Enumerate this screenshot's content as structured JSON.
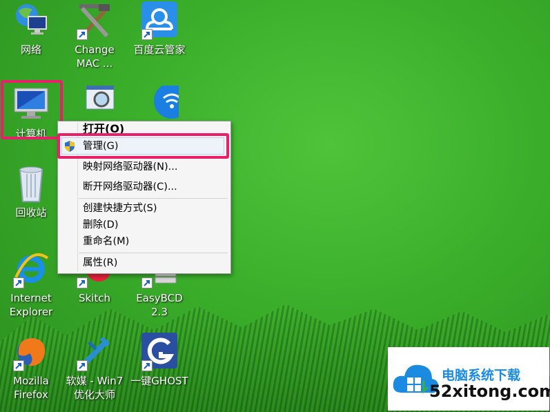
{
  "desktop": {
    "icons": [
      {
        "label": "网络",
        "icon": "network-icon"
      },
      {
        "label": "Change\nMAC ...",
        "icon": "change-mac-icon"
      },
      {
        "label": "百度云管家",
        "icon": "baidu-cloud-icon"
      },
      {
        "label": "计算机",
        "icon": "computer-icon"
      },
      {
        "label": "回收站",
        "icon": "recycle-bin-icon"
      },
      {
        "label": "Internet\nExplorer",
        "icon": "internet-explorer-icon"
      },
      {
        "label": "Skitch",
        "icon": "skitch-icon"
      },
      {
        "label": "EasyBCD\n2.3",
        "icon": "easybcd-icon"
      },
      {
        "label": "Mozilla\nFirefox",
        "icon": "firefox-icon"
      },
      {
        "label": "软媒 - Win7\n优化大师",
        "icon": "ruanmei-icon"
      },
      {
        "label": "一键GHOST",
        "icon": "ghost-icon"
      }
    ]
  },
  "context_menu": {
    "items": [
      {
        "label": "打开(O)"
      },
      {
        "label": "管理(G)"
      },
      {
        "label": "映射网络驱动器(N)..."
      },
      {
        "label": "断开网络驱动器(C)..."
      },
      {
        "label": "创建快捷方式(S)"
      },
      {
        "label": "删除(D)"
      },
      {
        "label": "重命名(M)"
      },
      {
        "label": "属性(R)"
      }
    ]
  },
  "watermark": {
    "line1": "电脑系统下载",
    "line2": "52xitong.com"
  },
  "colors": {
    "highlight": "#e8206a",
    "desktop_green": "#3aae2a",
    "watermark_blue": "#1a8be0"
  }
}
